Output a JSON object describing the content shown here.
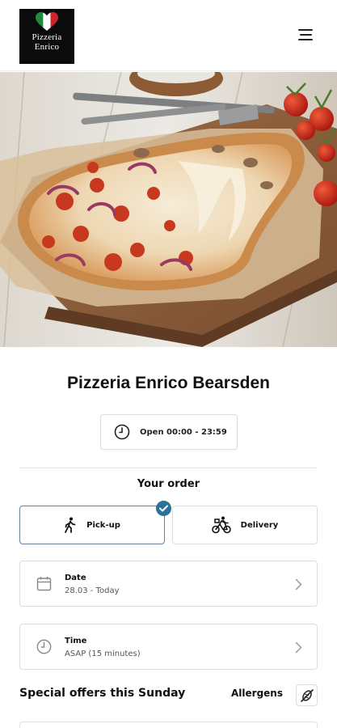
{
  "header": {
    "logo_line1": "Pizzeria",
    "logo_line2": "Enrico",
    "menu_icon": "hamburger-menu-icon"
  },
  "hero": {
    "image": "pizza-on-wooden-board"
  },
  "restaurant": {
    "name": "Pizzeria Enrico Bearsden",
    "hours": "Open 00:00 - 23:59"
  },
  "order": {
    "title": "Your order",
    "pickup_label": "Pick-up",
    "delivery_label": "Delivery",
    "selected": "pickup",
    "date_label": "Date",
    "date_value": "28.03 - Today",
    "time_label": "Time",
    "time_value": "ASAP (15 minutes)"
  },
  "offers": {
    "title": "Special offers this Sunday",
    "allergens_label": "Allergens"
  },
  "colors": {
    "accent": "#27739a",
    "selected_border": "#6a7f9e",
    "text": "#111111",
    "muted": "#555555",
    "border": "#dddddd"
  }
}
